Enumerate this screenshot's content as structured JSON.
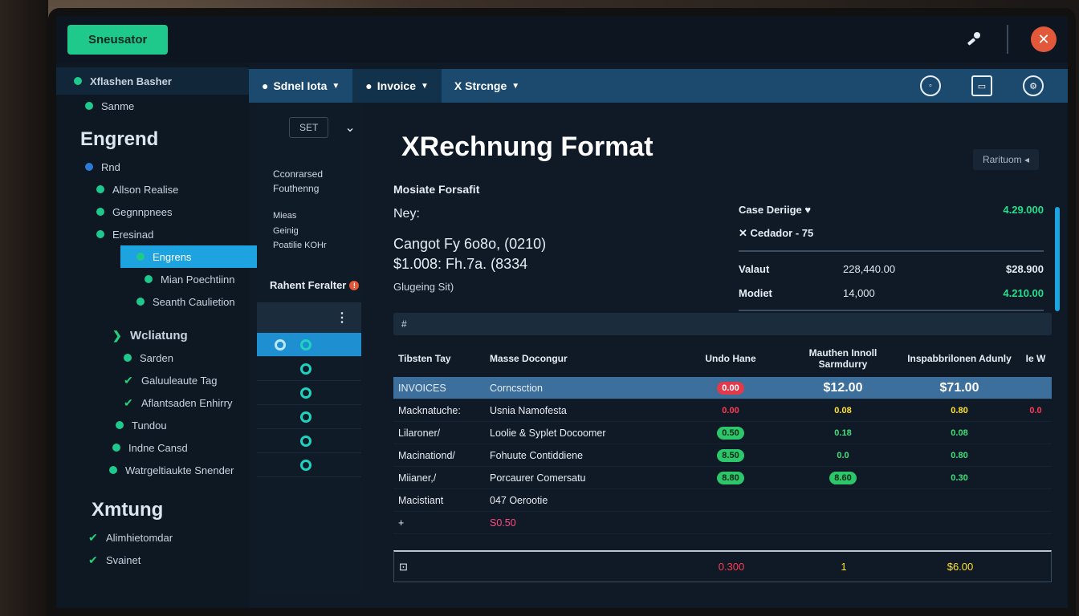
{
  "app": {
    "brand": "Sneusator"
  },
  "topbar": {
    "pin_icon": "pin-icon",
    "close_icon": "close-icon"
  },
  "sidebar": {
    "top_item": "Xflashen Basher",
    "items_a": [
      {
        "label": "Sanme",
        "icon": "dot"
      }
    ],
    "heading1": "Engrend",
    "items_b": [
      {
        "label": "Rnd",
        "icon": "dot"
      },
      {
        "label": "Allson Realise",
        "icon": "dot"
      },
      {
        "label": "Gegnnpnees",
        "icon": "dot"
      },
      {
        "label": "Eresinad",
        "icon": "dot"
      },
      {
        "label": "Engrens",
        "icon": "dot",
        "active": true
      },
      {
        "label": "Mian Poechtiinn",
        "icon": "dot"
      },
      {
        "label": "Seanth Caulietion",
        "icon": "dot"
      }
    ],
    "heading2_item": "Wcliatung",
    "items_c": [
      {
        "label": "Sarden",
        "icon": "check"
      },
      {
        "label": "Galuuleaute Tag",
        "icon": "check"
      },
      {
        "label": "Aflantsaden Enhirry",
        "icon": "check"
      },
      {
        "label": "Tundou",
        "icon": "check"
      },
      {
        "label": "Indne Cansd",
        "icon": "check"
      },
      {
        "label": "Watrgeltiaukte Snender",
        "icon": "check"
      }
    ],
    "heading3": "Xmtung",
    "items_d": [
      {
        "label": "Alimhietomdar",
        "icon": "check"
      },
      {
        "label": "Svainet",
        "icon": "check"
      }
    ]
  },
  "tabs": [
    {
      "label": "Sdnel Iota",
      "selected": false
    },
    {
      "label": "Invoice",
      "selected": true
    },
    {
      "label": "X Strcnge",
      "selected": false
    }
  ],
  "tab_tools": [
    "sync-icon",
    "window-icon",
    "gear-icon"
  ],
  "panel2": {
    "get_label": "SET",
    "label1": "Cconrarsed",
    "label2": "Fouthenng",
    "sub": [
      "Mieas",
      "Geinig",
      "Poatilie KOHr"
    ],
    "filter_label": "Rahent Feralter",
    "rows": 6
  },
  "main": {
    "title": "XRechnung Format",
    "right_button": "Rarituom",
    "info": {
      "line1": "Mosiate Forsafit",
      "line2": "Ney:",
      "line3": "Cangot Fy 6o8o, (0210)",
      "line4": "$1.008: Fh.7a. (8334",
      "line5": "Glugeing Sit)"
    },
    "summary": [
      {
        "key": "Case Deriige ♥",
        "mid": "",
        "value": "4.29.000",
        "green": true
      },
      {
        "key": "✕ Cedador - 75",
        "mid": "",
        "value": "",
        "green": false
      },
      {
        "key": "Valaut",
        "mid": "228,440.00",
        "value": "$28.900",
        "green": false
      },
      {
        "key": "Modiet",
        "mid": "14,000",
        "value": "4.210.00",
        "green": true
      }
    ],
    "table": {
      "toolbar": "#",
      "headers": [
        "Tibsten Tay",
        "Masse Docongur",
        "Undo Hane",
        "Mauthen Innoll Sarmdurry",
        "Inspabbrilonen Adunly",
        "Ie W"
      ],
      "rows": [
        {
          "c1": "INVOICES",
          "c2": "Corncsction",
          "c3": "0.00",
          "c3s": "p-red",
          "c4": "$12.00",
          "c4s": "p-white",
          "c5": "$71.00",
          "c5s": "p-white",
          "c6": "",
          "sel": true
        },
        {
          "c1": "Macknatuche:",
          "c2": "Usnia Namofesta",
          "c3": "0.00",
          "c3s": "p-redt",
          "c4": "0.08",
          "c4s": "p-yellow",
          "c5": "0.80",
          "c5s": "p-yellow",
          "c6": "0.0",
          "sel": false
        },
        {
          "c1": "Lilaroner/",
          "c2": "Loolie & Syplet Docoomer",
          "c3": "0.50",
          "c3s": "p-green",
          "c4": "0.18",
          "c4s": "p-greent",
          "c5": "0.08",
          "c5s": "p-greent",
          "c6": "",
          "sel": false
        },
        {
          "c1": "Macinationd/",
          "c2": "Fohuute Contiddiene",
          "c3": "8.50",
          "c3s": "p-green",
          "c4": "0.0",
          "c4s": "p-greent",
          "c5": "0.80",
          "c5s": "p-greent",
          "c6": "",
          "sel": false
        },
        {
          "c1": "Miianer,/",
          "c2": "Porcaurer Comersatu",
          "c3": "8.80",
          "c3s": "p-green",
          "c4": "8.60",
          "c4s": "p-green",
          "c5": "0.30",
          "c5s": "p-greent",
          "c6": "",
          "sel": false
        },
        {
          "c1": "Macistiant",
          "c2": "047 Oerootie",
          "c3": "",
          "c3s": "",
          "c4": "",
          "c4s": "",
          "c5": "",
          "c5s": "",
          "c6": "",
          "sel": false
        }
      ],
      "subtotal_row": {
        "c1": "+",
        "c2": "S0.50"
      },
      "footer": {
        "icon": "calc-icon",
        "total1": "0.300",
        "total2": "1",
        "total3": "$6.00"
      }
    }
  },
  "colors": {
    "accent_green": "#1fc98c",
    "tab_blue": "#1c4a6e",
    "active_blue": "#1da3e0",
    "close_orange": "#e2583a"
  }
}
